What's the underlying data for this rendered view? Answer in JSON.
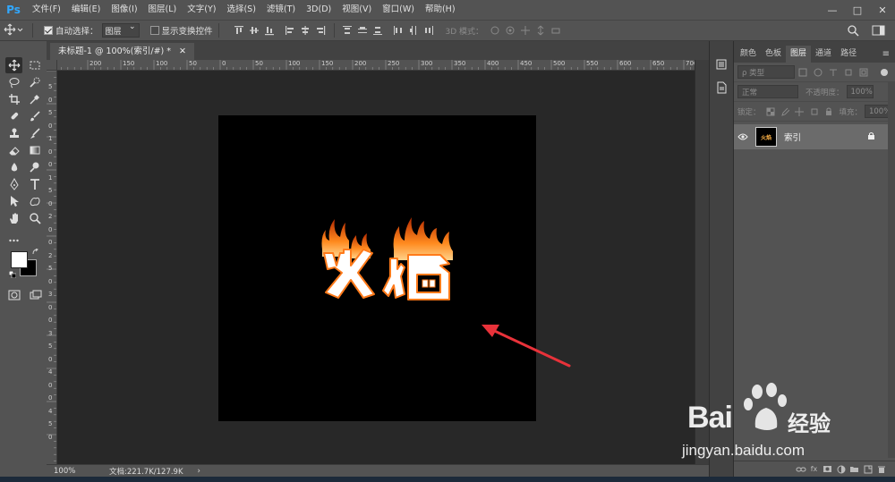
{
  "app": {
    "logo": "Ps"
  },
  "menu": [
    "文件(F)",
    "编辑(E)",
    "图像(I)",
    "图层(L)",
    "文字(Y)",
    "选择(S)",
    "滤镜(T)",
    "3D(D)",
    "视图(V)",
    "窗口(W)",
    "帮助(H)"
  ],
  "window_controls": [
    "—",
    "□",
    "✕"
  ],
  "options": {
    "auto_select_label": "自动选择：",
    "auto_select_value": "图层",
    "show_transform_label": "显示变换控件",
    "mode_3d_label": "3D 模式："
  },
  "document": {
    "tab_label": "未标题-1 @ 100%(索引/#) *",
    "text_content": "火焰",
    "zoom": "100%",
    "doc_size": "文档:221.7K/127.9K",
    "status_arrow": "›"
  },
  "ruler_top_labels": [
    "200",
    "150",
    "100",
    "50",
    "0",
    "50",
    "100",
    "150",
    "200",
    "250",
    "300",
    "350",
    "400",
    "450",
    "500",
    "550",
    "600",
    "650",
    "700"
  ],
  "ruler_left_labels": [
    "5",
    "0",
    "5",
    "0",
    "1",
    "0",
    "0",
    "1",
    "5",
    "0",
    "2",
    "0",
    "0",
    "2",
    "5",
    "0",
    "3",
    "0",
    "0",
    "3",
    "5",
    "0",
    "4",
    "0",
    "0",
    "4",
    "5",
    "0"
  ],
  "panel": {
    "tabs": [
      "颜色",
      "色板",
      "图层",
      "通道",
      "路径"
    ],
    "filter_kind": "ρ 类型",
    "blend_mode": "正常",
    "opacity_label": "不透明度：",
    "opacity_value": "100%",
    "lock_label": "锁定：",
    "fill_label": "填充：",
    "fill_value": "100%",
    "layer_name": "索引",
    "footer_icons": [
      "fx"
    ]
  },
  "watermark": {
    "brand": "Bai",
    "brand_cn": "经验",
    "url": "jingyan.baidu.com"
  },
  "colors": {
    "foreground": "#ffffff",
    "background": "#000000",
    "arrow": "#e8323a",
    "ps_blue": "#31a8ff"
  }
}
